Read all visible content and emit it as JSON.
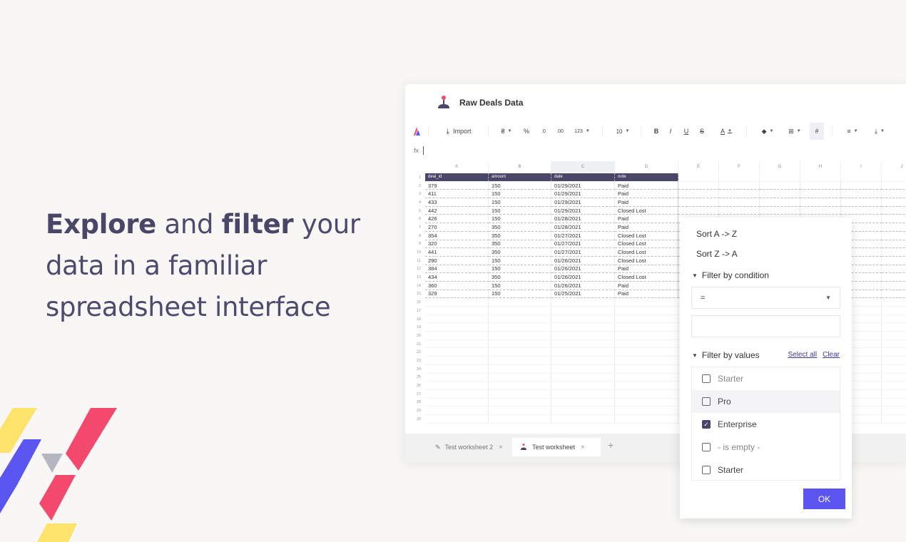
{
  "headline": {
    "part1": "Explore",
    "part2": " and ",
    "part3": "filter",
    "part4": " your data in a familiar spreadsheet interface"
  },
  "app": {
    "title": "Raw Deals Data",
    "toolbar": {
      "import_label": "Import",
      "currency": "₴",
      "percent": "%",
      "dec_less": ".0",
      "dec_more": ".00",
      "number_format": "123",
      "font_size": "10",
      "bold": "B",
      "italic": "I",
      "underline": "U",
      "strike": "S",
      "text_color": "A"
    },
    "formula_label": "fx",
    "columns": [
      "A",
      "B",
      "C",
      "D",
      "E",
      "F",
      "G",
      "H",
      "I",
      "J"
    ],
    "header_row": [
      "deal_id",
      "amount",
      "date",
      "note"
    ],
    "rows": [
      [
        "379",
        "150",
        "01/29/2021",
        "Paid"
      ],
      [
        "411",
        "150",
        "01/29/2021",
        "Paid"
      ],
      [
        "433",
        "150",
        "01/29/2021",
        "Paid"
      ],
      [
        "442",
        "150",
        "01/29/2021",
        "Closed Lost"
      ],
      [
        "426",
        "150",
        "01/28/2021",
        "Paid"
      ],
      [
        "270",
        "350",
        "01/28/2021",
        "Paid"
      ],
      [
        "354",
        "350",
        "01/27/2021",
        "Closed Lost"
      ],
      [
        "320",
        "350",
        "01/27/2021",
        "Closed Lost"
      ],
      [
        "441",
        "350",
        "01/27/2021",
        "Closed Lost"
      ],
      [
        "290",
        "150",
        "01/26/2021",
        "Closed Lost"
      ],
      [
        "384",
        "150",
        "01/26/2021",
        "Paid"
      ],
      [
        "434",
        "350",
        "01/26/2021",
        "Closed Lost"
      ],
      [
        "360",
        "150",
        "01/26/2021",
        "Paid"
      ],
      [
        "329",
        "150",
        "01/25/2021",
        "Paid"
      ]
    ],
    "row_numbers": [
      "1",
      "2",
      "3",
      "4",
      "5",
      "6",
      "7",
      "8",
      "9",
      "10",
      "11",
      "12",
      "13",
      "14",
      "15",
      "16",
      "17",
      "18",
      "19",
      "20",
      "21",
      "22",
      "23",
      "24",
      "25",
      "26",
      "27",
      "28",
      "29",
      "30"
    ],
    "tabs": [
      {
        "label": "Test worksheet 2",
        "close": "×"
      },
      {
        "label": "Test worksheet",
        "close": "×"
      }
    ],
    "add_tab": "+"
  },
  "filter_panel": {
    "sort_az": "Sort A -> Z",
    "sort_za": "Sort Z -> A",
    "by_condition": "Filter by condition",
    "condition_value": "=",
    "by_values": "Filter by values",
    "select_all": "Select all",
    "clear": "Clear",
    "values": [
      {
        "label": "Starter",
        "checked": false
      },
      {
        "label": "Pro",
        "checked": false
      },
      {
        "label": "Enterprise",
        "checked": true
      },
      {
        "label": "- is empty -",
        "checked": false
      },
      {
        "label": "Starter",
        "checked": false
      }
    ],
    "ok_label": "OK"
  },
  "colors": {
    "accent": "#5b54ef",
    "header_dark": "#4a4668",
    "deco_yellow": "#fde36a",
    "deco_pink": "#f2496d",
    "deco_blue": "#5a55f0",
    "deco_gray": "#b5b7c0"
  }
}
